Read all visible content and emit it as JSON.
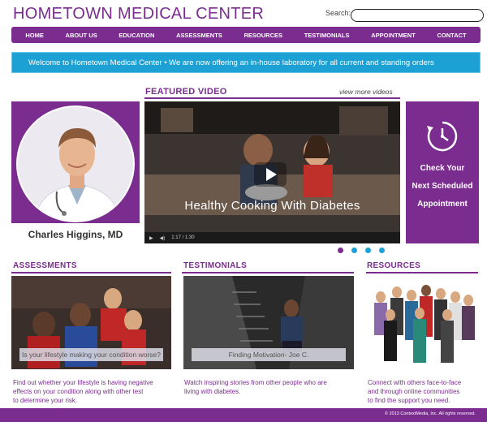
{
  "header": {
    "site_title": "HOMETOWN MEDICAL CENTER",
    "search_label": "Search:",
    "search_placeholder": ""
  },
  "nav": {
    "items": [
      "HOME",
      "ABOUT US",
      "EDUCATION",
      "ASSESSMENTS",
      "RESOURCES",
      "TESTIMONIALS",
      "APPOINTMENT",
      "CONTACT"
    ]
  },
  "banner": {
    "text": "Welcome to Hometown Medical Center •  We are now offering an in-house laboratory for all current and standing orders"
  },
  "doctor": {
    "name": "Charles Higgins, MD"
  },
  "featured": {
    "title": "FEATURED VIDEO",
    "view_more": "view more videos",
    "video_caption": "Healthy Cooking With Diabetes",
    "time": "1:17 / 1:30",
    "slide_count": 4,
    "active_slide": 1
  },
  "appointment": {
    "lines": [
      "Check Your",
      "Next Scheduled",
      "Appointment"
    ],
    "icon": "clock-icon"
  },
  "sections": {
    "assessments": {
      "title": "ASSESSMENTS",
      "overlay": "Is your lifestyle making your condition worse?",
      "text": [
        "Find out whether your lifestyle is having negative",
        "effects on your condition along with other test",
        "to determine your risk."
      ]
    },
    "testimonials": {
      "title": "TESTIMONIALS",
      "overlay": "Finding Motivation- Joe C.",
      "text": [
        "Watch inspiring stories from other people who are",
        "living with diabetes."
      ]
    },
    "resources": {
      "title": "RESOURCES",
      "text": [
        "Connect with others face-to-face",
        "and through online communities",
        "to find the support you need."
      ]
    }
  },
  "footer": {
    "copyright": "© 2013 ContextMedia, Inc. All rights reserved."
  },
  "colors": {
    "brand_purple": "#7a2c8f",
    "accent_blue": "#1da1d4"
  }
}
